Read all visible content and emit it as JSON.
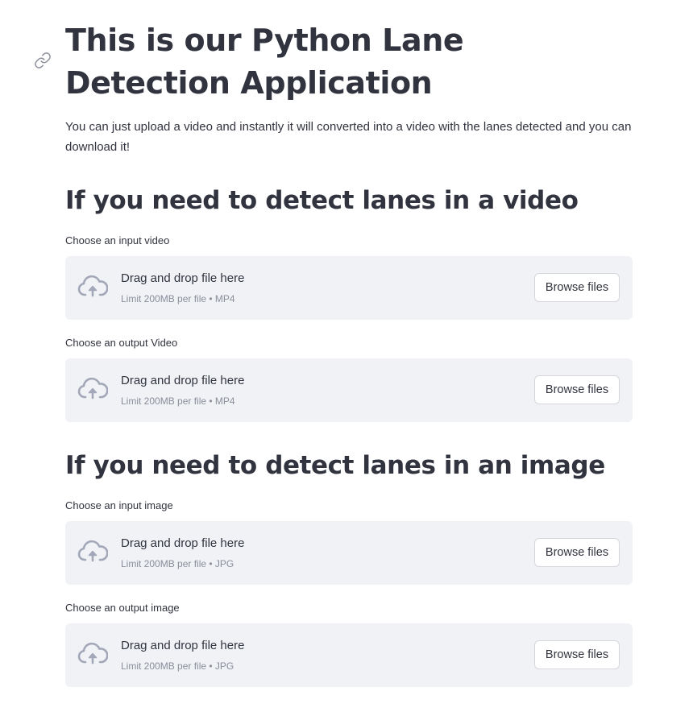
{
  "page": {
    "title": "This is our Python Lane Detection Application",
    "intro": "You can just upload a video and instantly it will converted into a video with the lanes detected and you can download it!"
  },
  "sections": [
    {
      "heading": "If you need to detect lanes in a video",
      "uploaders": [
        {
          "label": "Choose an input video",
          "drop_text": "Drag and drop file here",
          "limit_text": "Limit 200MB per file • MP4",
          "button_label": "Browse files"
        },
        {
          "label": "Choose an output Video",
          "drop_text": "Drag and drop file here",
          "limit_text": "Limit 200MB per file • MP4",
          "button_label": "Browse files"
        }
      ]
    },
    {
      "heading": "If you need to detect lanes in an image",
      "uploaders": [
        {
          "label": "Choose an input image",
          "drop_text": "Drag and drop file here",
          "limit_text": "Limit 200MB per file • JPG",
          "button_label": "Browse files"
        },
        {
          "label": "Choose an output image",
          "drop_text": "Drag and drop file here",
          "limit_text": "Limit 200MB per file • JPG",
          "button_label": "Browse files"
        }
      ]
    }
  ],
  "icons": {
    "anchor": "link-icon",
    "upload": "cloud-upload-icon"
  },
  "colors": {
    "text": "#31333f",
    "muted": "#8a8e9a",
    "dropzone_bg": "#f0f2f6",
    "icon": "#a3a8b8"
  }
}
